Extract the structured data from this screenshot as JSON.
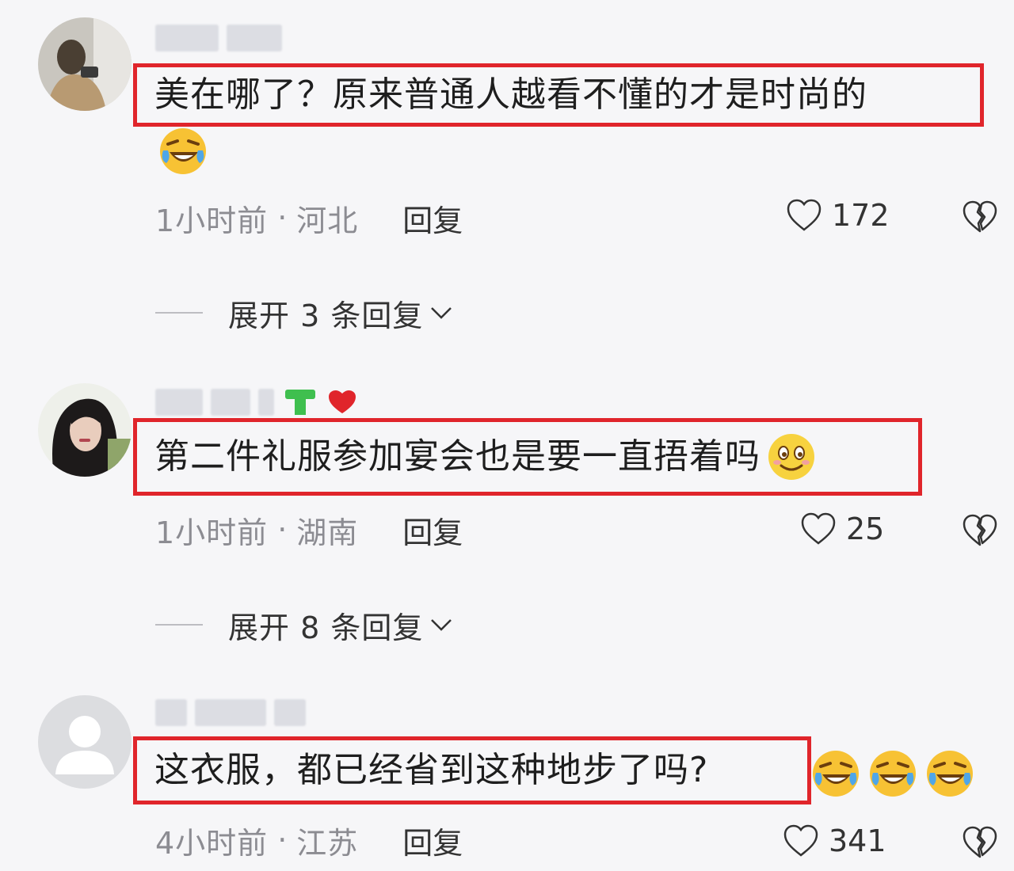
{
  "comments": [
    {
      "text": "美在哪了？原来普通人越看不懂的才是时尚的",
      "time": "1小时前",
      "location": "河北",
      "reply_label": "回复",
      "likes": "172",
      "expand_label": "展开 3 条回复",
      "emoji": "laugh-cry"
    },
    {
      "text": "第二件礼服参加宴会也是要一直捂着吗",
      "time": "1小时前",
      "location": "湖南",
      "reply_label": "回复",
      "likes": "25",
      "expand_label": "展开 8 条回复",
      "emoji": "smile"
    },
    {
      "text": "这衣服，都已经省到这种地步了吗?",
      "time": "4小时前",
      "location": "江苏",
      "reply_label": "回复",
      "likes": "341",
      "emoji": "laugh-cry"
    }
  ],
  "separator": "·",
  "icons": {
    "like": "heart-outline-icon",
    "dislike": "broken-heart-icon",
    "expand": "chevron-down-icon"
  },
  "colors": {
    "highlight_border": "#e0252b",
    "background": "#f6f6f8",
    "meta_text": "#8c8c92"
  }
}
